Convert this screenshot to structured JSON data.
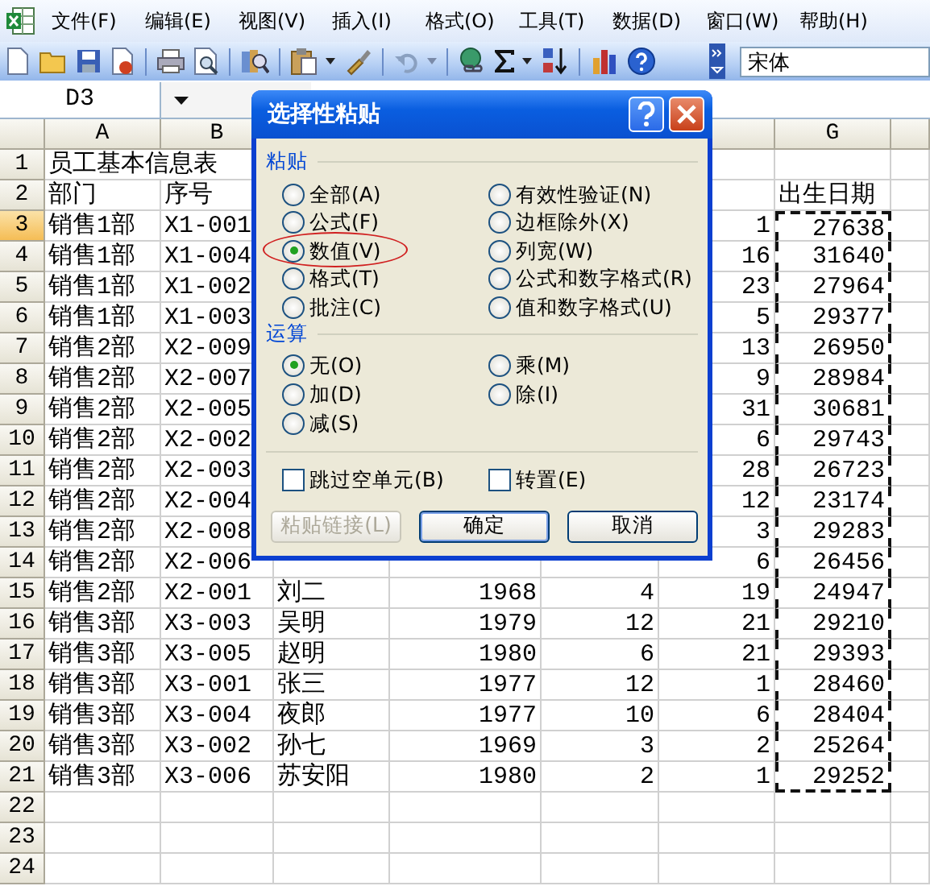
{
  "menu_bar": {
    "items": [
      "文件(F)",
      "编辑(E)",
      "视图(V)",
      "插入(I)",
      "格式(O)",
      "工具(T)",
      "数据(D)",
      "窗口(W)",
      "帮助(H)"
    ]
  },
  "toolbar": {
    "font_name": "宋体"
  },
  "formula_bar": {
    "name_box": "D3"
  },
  "sheet": {
    "columns": [
      "A",
      "B",
      null,
      null,
      null,
      null,
      "G",
      null
    ],
    "rows": [
      {
        "number": "1",
        "kind": "title",
        "selected": false,
        "copied": false,
        "cells": [
          "员工基本信息表",
          null,
          null,
          null,
          null,
          null,
          null,
          null
        ]
      },
      {
        "number": "2",
        "kind": "header",
        "selected": false,
        "copied": false,
        "cells": [
          "部门",
          "序号",
          null,
          null,
          null,
          null,
          "出生日期",
          null
        ]
      },
      {
        "number": "3",
        "kind": "data",
        "selected": true,
        "copied": true,
        "cells": [
          "销售1部",
          "X1-001",
          null,
          null,
          null,
          "1",
          "27638",
          null
        ]
      },
      {
        "number": "4",
        "kind": "data",
        "selected": false,
        "copied": true,
        "cells": [
          "销售1部",
          "X1-004",
          null,
          null,
          null,
          "16",
          "31640",
          null
        ]
      },
      {
        "number": "5",
        "kind": "data",
        "selected": false,
        "copied": true,
        "cells": [
          "销售1部",
          "X1-002",
          null,
          null,
          null,
          "23",
          "27964",
          null
        ]
      },
      {
        "number": "6",
        "kind": "data",
        "selected": false,
        "copied": true,
        "cells": [
          "销售1部",
          "X1-003",
          null,
          null,
          null,
          "5",
          "29377",
          null
        ]
      },
      {
        "number": "7",
        "kind": "data",
        "selected": false,
        "copied": true,
        "cells": [
          "销售2部",
          "X2-009",
          null,
          null,
          null,
          "13",
          "26950",
          null
        ]
      },
      {
        "number": "8",
        "kind": "data",
        "selected": false,
        "copied": true,
        "cells": [
          "销售2部",
          "X2-007",
          null,
          null,
          null,
          "9",
          "28984",
          null
        ]
      },
      {
        "number": "9",
        "kind": "data",
        "selected": false,
        "copied": true,
        "cells": [
          "销售2部",
          "X2-005",
          null,
          null,
          null,
          "31",
          "30681",
          null
        ]
      },
      {
        "number": "10",
        "kind": "data",
        "selected": false,
        "copied": true,
        "cells": [
          "销售2部",
          "X2-002",
          null,
          null,
          null,
          "6",
          "29743",
          null
        ]
      },
      {
        "number": "11",
        "kind": "data",
        "selected": false,
        "copied": true,
        "cells": [
          "销售2部",
          "X2-003",
          null,
          null,
          null,
          "28",
          "26723",
          null
        ]
      },
      {
        "number": "12",
        "kind": "data",
        "selected": false,
        "copied": true,
        "cells": [
          "销售2部",
          "X2-004",
          null,
          null,
          null,
          "12",
          "23174",
          null
        ]
      },
      {
        "number": "13",
        "kind": "data",
        "selected": false,
        "copied": true,
        "cells": [
          "销售2部",
          "X2-008",
          null,
          null,
          null,
          "3",
          "29283",
          null
        ]
      },
      {
        "number": "14",
        "kind": "data",
        "selected": false,
        "copied": true,
        "cells": [
          "销售2部",
          "X2-006",
          null,
          null,
          null,
          "6",
          "26456",
          null
        ]
      },
      {
        "number": "15",
        "kind": "data",
        "selected": false,
        "copied": true,
        "cells": [
          "销售2部",
          "X2-001",
          "刘二",
          "1968",
          "4",
          "19",
          "24947",
          null
        ]
      },
      {
        "number": "16",
        "kind": "data",
        "selected": false,
        "copied": true,
        "cells": [
          "销售3部",
          "X3-003",
          "吴明",
          "1979",
          "12",
          "21",
          "29210",
          null
        ]
      },
      {
        "number": "17",
        "kind": "data",
        "selected": false,
        "copied": true,
        "cells": [
          "销售3部",
          "X3-005",
          "赵明",
          "1980",
          "6",
          "21",
          "29393",
          null
        ]
      },
      {
        "number": "18",
        "kind": "data",
        "selected": false,
        "copied": true,
        "cells": [
          "销售3部",
          "X3-001",
          "张三",
          "1977",
          "12",
          "1",
          "28460",
          null
        ]
      },
      {
        "number": "19",
        "kind": "data",
        "selected": false,
        "copied": true,
        "cells": [
          "销售3部",
          "X3-004",
          "夜郎",
          "1977",
          "10",
          "6",
          "28404",
          null
        ]
      },
      {
        "number": "20",
        "kind": "data",
        "selected": false,
        "copied": true,
        "cells": [
          "销售3部",
          "X3-002",
          "孙七",
          "1969",
          "3",
          "2",
          "25264",
          null
        ]
      },
      {
        "number": "21",
        "kind": "data",
        "selected": false,
        "copied": true,
        "cells": [
          "销售3部",
          "X3-006",
          "苏安阳",
          "1980",
          "2",
          "1",
          "29252",
          null
        ]
      },
      {
        "number": "22",
        "kind": "data",
        "selected": false,
        "copied": false,
        "cells": [
          null,
          null,
          null,
          null,
          null,
          null,
          null,
          null
        ]
      },
      {
        "number": "23",
        "kind": "data",
        "selected": false,
        "copied": false,
        "cells": [
          null,
          null,
          null,
          null,
          null,
          null,
          null,
          null
        ]
      },
      {
        "number": "24",
        "kind": "data",
        "selected": false,
        "copied": false,
        "cells": [
          null,
          null,
          null,
          null,
          null,
          null,
          null,
          null
        ]
      }
    ]
  },
  "dialog": {
    "title": "选择性粘贴",
    "paste_label": "粘贴",
    "paste_options": [
      {
        "label": "全部(A)",
        "selected": false,
        "circled": false
      },
      {
        "label": "有效性验证(N)",
        "selected": false,
        "circled": false
      },
      {
        "label": "公式(F)",
        "selected": false,
        "circled": false
      },
      {
        "label": "边框除外(X)",
        "selected": false,
        "circled": false
      },
      {
        "label": "数值(V)",
        "selected": true,
        "circled": true
      },
      {
        "label": "列宽(W)",
        "selected": false,
        "circled": false
      },
      {
        "label": "格式(T)",
        "selected": false,
        "circled": false
      },
      {
        "label": "公式和数字格式(R)",
        "selected": false,
        "circled": false
      },
      {
        "label": "批注(C)",
        "selected": false,
        "circled": false
      },
      {
        "label": "值和数字格式(U)",
        "selected": false,
        "circled": false
      }
    ],
    "operation_label": "运算",
    "operation_options": [
      {
        "label": "无(O)",
        "selected": true
      },
      {
        "label": "乘(M)",
        "selected": false
      },
      {
        "label": "加(D)",
        "selected": false
      },
      {
        "label": "除(I)",
        "selected": false
      },
      {
        "label": "减(S)",
        "selected": false
      }
    ],
    "checkboxes": [
      {
        "label": "跳过空单元(B)",
        "checked": false
      },
      {
        "label": "转置(E)",
        "checked": false
      }
    ],
    "buttons": [
      {
        "label": "粘贴链接(L)",
        "disabled": true,
        "default": false
      },
      {
        "label": "确定",
        "disabled": false,
        "default": true
      },
      {
        "label": "取消",
        "disabled": false,
        "default": false
      }
    ]
  }
}
